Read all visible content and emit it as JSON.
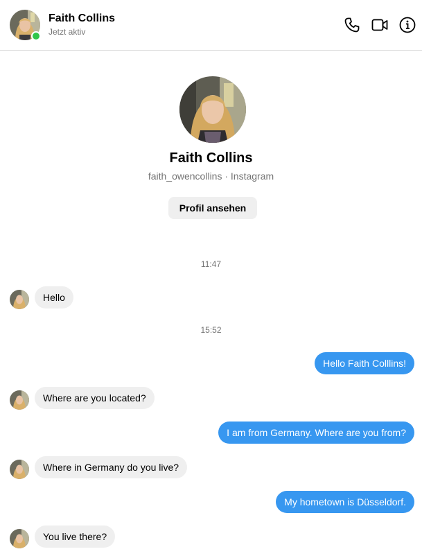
{
  "header": {
    "name": "Faith Collins",
    "status": "Jetzt aktiv",
    "status_color": "#31c64a",
    "icons": [
      "phone-icon",
      "video-camera-icon",
      "info-icon"
    ]
  },
  "profile": {
    "name": "Faith Collins",
    "subtitle": "faith_owencollins · Instagram",
    "view_profile_label": "Profil ansehen"
  },
  "colors": {
    "outgoing_bubble": "#3797f0",
    "incoming_bubble": "#efefef"
  },
  "conversation": [
    {
      "type": "timestamp",
      "text": "11:47"
    },
    {
      "type": "incoming",
      "text": "Hello"
    },
    {
      "type": "timestamp",
      "text": "15:52"
    },
    {
      "type": "outgoing",
      "text": "Hello Faith Colllins!"
    },
    {
      "type": "incoming",
      "text": "Where are you located?"
    },
    {
      "type": "outgoing",
      "text": "I am from Germany. Where are you from?"
    },
    {
      "type": "incoming",
      "text": "Where in Germany do you live?"
    },
    {
      "type": "outgoing",
      "text": "My hometown is Düsseldorf."
    },
    {
      "type": "incoming",
      "text": "You live there?"
    }
  ]
}
